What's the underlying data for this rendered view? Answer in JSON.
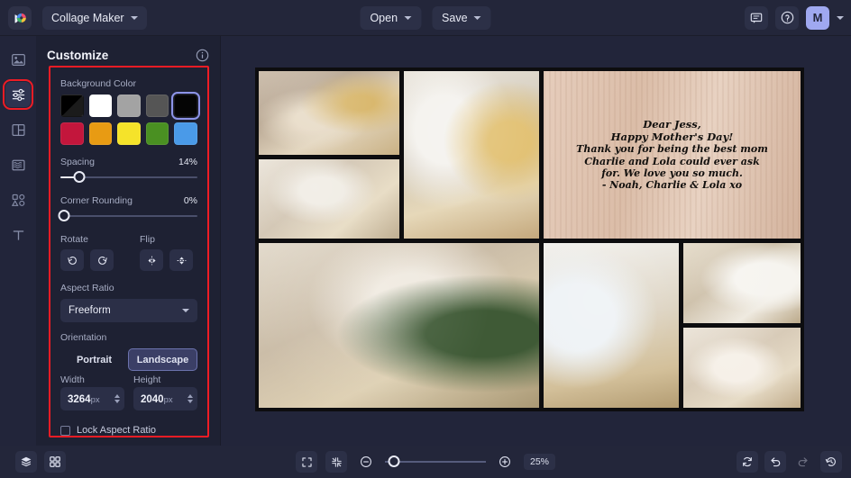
{
  "app": {
    "logo_icon": "color-wheel-logo",
    "document_name": "Collage Maker"
  },
  "topbar": {
    "open_label": "Open",
    "save_label": "Save",
    "feedback_icon": "chat-bubble-icon",
    "help_icon": "help-circle-icon",
    "avatar_initial": "M"
  },
  "rail": {
    "items": [
      {
        "icon": "image-icon",
        "name": "images"
      },
      {
        "icon": "sliders-icon",
        "name": "customize"
      },
      {
        "icon": "layout-icon",
        "name": "layouts"
      },
      {
        "icon": "borders-icon",
        "name": "borders"
      },
      {
        "icon": "shapes-icon",
        "name": "shapes"
      },
      {
        "icon": "text-icon",
        "name": "text"
      }
    ],
    "active_index": 1
  },
  "panel": {
    "title": "Customize",
    "info_icon": "info-circle-icon",
    "background": {
      "label": "Background Color",
      "swatches": [
        {
          "name": "black-transparent",
          "hex": "#000000"
        },
        {
          "name": "white",
          "hex": "#ffffff"
        },
        {
          "name": "light-gray",
          "hex": "#a3a3a3"
        },
        {
          "name": "dark-gray",
          "hex": "#555555"
        },
        {
          "name": "black",
          "hex": "#050505"
        },
        {
          "name": "crimson",
          "hex": "#c3163c"
        },
        {
          "name": "amber",
          "hex": "#e89b13"
        },
        {
          "name": "yellow",
          "hex": "#f5e32a"
        },
        {
          "name": "green",
          "hex": "#4a9022"
        },
        {
          "name": "blue",
          "hex": "#4a9ae8"
        }
      ],
      "selected_index": 4
    },
    "spacing": {
      "label": "Spacing",
      "value": "14%",
      "percent": 14
    },
    "corner_rounding": {
      "label": "Corner Rounding",
      "value": "0%",
      "percent": 0
    },
    "rotate": {
      "label": "Rotate",
      "ccw_icon": "rotate-counterclockwise-icon",
      "cw_icon": "rotate-clockwise-icon"
    },
    "flip": {
      "label": "Flip",
      "horizontal_icon": "flip-horizontal-icon",
      "vertical_icon": "flip-vertical-icon"
    },
    "aspect_ratio": {
      "label": "Aspect Ratio",
      "value": "Freeform"
    },
    "orientation": {
      "label": "Orientation",
      "portrait_label": "Portrait",
      "landscape_label": "Landscape",
      "selected": "Landscape"
    },
    "width": {
      "label": "Width",
      "value": "3264",
      "unit": "px"
    },
    "height": {
      "label": "Height",
      "value": "2040",
      "unit": "px"
    },
    "lock_aspect": {
      "label": "Lock Aspect Ratio",
      "checked": false
    },
    "highlight_color": "#ee1c25"
  },
  "canvas": {
    "background_color": "#0d0d0f",
    "photos": [
      {
        "name": "photo-mother-with-two-children"
      },
      {
        "name": "photo-mother-kissing-toddler"
      },
      {
        "name": "photo-mother-hugging-child-by-window"
      },
      {
        "name": "photo-family-portrait-with-plant"
      },
      {
        "name": "photo-family-standing-by-window"
      },
      {
        "name": "photo-children-lying-on-rug"
      },
      {
        "name": "photo-mother-and-daughter-embrace"
      }
    ],
    "note_card": {
      "name": "mothers-day-message-card",
      "lines": [
        "Dear Jess,",
        "Happy Mother's Day!",
        "Thank you for being the best mom",
        "Charlie and Lola could ever ask",
        "for. We love you so much.",
        "- Noah, Charlie & Lola  xo"
      ]
    }
  },
  "bottombar": {
    "layers_icon": "layers-icon",
    "grid_icon": "grid-icon",
    "fullscreen_icon": "expand-icon",
    "fit_icon": "collapse-icon",
    "zoom_out_icon": "zoom-out-icon",
    "zoom_in_icon": "zoom-in-icon",
    "zoom_value": "25%",
    "zoom_percent": 25,
    "reset_icon": "reset-icon",
    "undo_icon": "undo-icon",
    "redo_icon": "redo-icon",
    "history_icon": "history-icon"
  }
}
